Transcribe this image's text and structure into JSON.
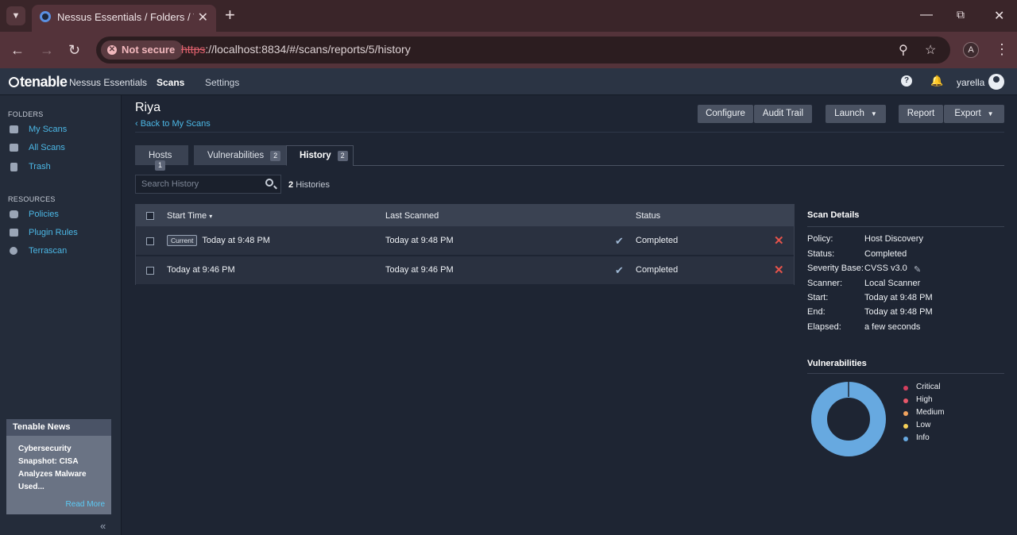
{
  "browser": {
    "tab_title": "Nessus Essentials / Folders / View Scan",
    "security_label": "Not secure",
    "url_scheme": "https",
    "url_rest": "://localhost:8834/#/scans/reports/5/history",
    "profile_initial": "A"
  },
  "header": {
    "logo": "tenable",
    "product": "Nessus Essentials",
    "nav": [
      "Scans",
      "Settings"
    ],
    "help": "?",
    "username": "yarella"
  },
  "sidebar": {
    "folders_heading": "FOLDERS",
    "folders": [
      "My Scans",
      "All Scans",
      "Trash"
    ],
    "resources_heading": "RESOURCES",
    "resources": [
      "Policies",
      "Plugin Rules",
      "Terrascan"
    ],
    "news": {
      "heading": "Tenable News",
      "headline": "Cybersecurity Snapshot: CISA Analyzes Malware Used...",
      "read_more": "Read More"
    },
    "collapse": "«"
  },
  "main": {
    "title": "Riya",
    "back_link": "‹ Back to My Scans",
    "buttons": {
      "configure": "Configure",
      "audit_trail": "Audit Trail",
      "launch": "Launch",
      "report": "Report",
      "export": "Export"
    },
    "tabs": [
      {
        "label": "Hosts",
        "count": "1"
      },
      {
        "label": "Vulnerabilities",
        "count": "2"
      },
      {
        "label": "History",
        "count": "2"
      }
    ],
    "search_placeholder": "Search History",
    "history_count": "2",
    "history_count_label": "Histories",
    "table": {
      "headers": [
        "Start Time",
        "Last Scanned",
        "Status"
      ],
      "sort_indicator": "▾",
      "rows": [
        {
          "badge": "Current",
          "start": "Today at 9:48 PM",
          "last_scanned": "Today at 9:48 PM",
          "status": "Completed"
        },
        {
          "badge": "",
          "start": "Today at 9:46 PM",
          "last_scanned": "Today at 9:46 PM",
          "status": "Completed"
        }
      ]
    }
  },
  "scan_details": {
    "title": "Scan Details",
    "rows": [
      {
        "label": "Policy:",
        "value": "Host Discovery"
      },
      {
        "label": "Status:",
        "value": "Completed"
      },
      {
        "label": "Severity Base:",
        "value": "CVSS v3.0"
      },
      {
        "label": "Scanner:",
        "value": "Local Scanner"
      },
      {
        "label": "Start:",
        "value": "Today at 9:48 PM"
      },
      {
        "label": "End:",
        "value": "Today at 9:48 PM"
      },
      {
        "label": "Elapsed:",
        "value": "a few seconds"
      }
    ]
  },
  "vulnerabilities": {
    "title": "Vulnerabilities",
    "legend": [
      {
        "label": "Critical",
        "color": "#d43f5e",
        "value": 0
      },
      {
        "label": "High",
        "color": "#e8586a",
        "value": 0
      },
      {
        "label": "Medium",
        "color": "#f0a35e",
        "value": 0
      },
      {
        "label": "Low",
        "color": "#f6d158",
        "value": 0
      },
      {
        "label": "Info",
        "color": "#67a9e0",
        "value": 1
      }
    ]
  }
}
